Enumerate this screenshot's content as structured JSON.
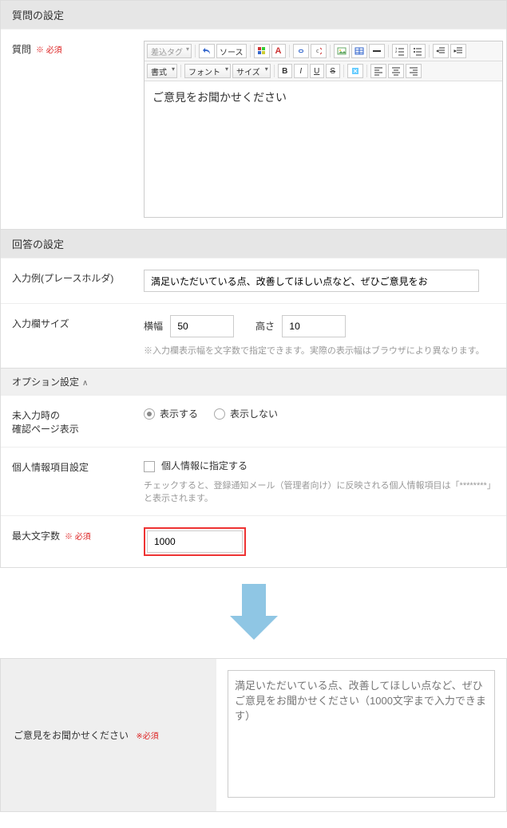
{
  "sections": {
    "question_header": "質問の設定",
    "answer_header": "回答の設定",
    "option_header": "オプション設定"
  },
  "labels": {
    "question": "質問",
    "required": "※ 必須",
    "required2": "※必須",
    "placeholder_example": "入力例(プレースホルダ)",
    "input_size": "入力欄サイズ",
    "width": "横幅",
    "height": "高さ",
    "size_hint": "※入力欄表示幅を文字数で指定できます。実際の表示幅はブラウザにより異なります。",
    "no_input_display": "未入力時の\n確認ページ表示",
    "show": "表示する",
    "hide": "表示しない",
    "privacy_setting": "個人情報項目設定",
    "privacy_checkbox": "個人情報に指定する",
    "privacy_hint": "チェックすると、登録通知メール（管理者向け）に反映される個人情報項目は「********」と表示されます。",
    "max_chars": "最大文字数"
  },
  "toolbar": {
    "insert_tag": "差込タグ",
    "source": "ソース",
    "format": "書式",
    "font": "フォント",
    "size": "サイズ",
    "bold": "B",
    "italic": "I",
    "underline": "U",
    "strike": "S"
  },
  "editor": {
    "content": "ご意見をお聞かせください"
  },
  "values": {
    "placeholder_text": "満足いただいている点、改善してほしい点など、ぜひご意見をお",
    "width_val": "50",
    "height_val": "10",
    "max_chars_val": "1000"
  },
  "preview": {
    "label": "ご意見をお聞かせください",
    "placeholder": "満足いただいている点、改善してほしい点など、ぜひご意見をお聞かせください（1000文字まで入力できます）"
  }
}
